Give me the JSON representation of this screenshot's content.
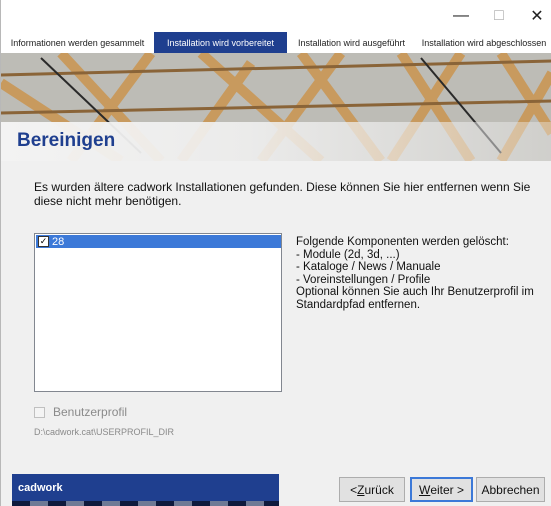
{
  "window": {
    "min_icon": "minimize-icon",
    "max_icon": "maximize-icon",
    "close_icon": "close-icon"
  },
  "steps": [
    {
      "label": "Informationen werden gesammelt"
    },
    {
      "label": "Installation wird vorbereitet"
    },
    {
      "label": "Installation wird ausgeführt"
    },
    {
      "label": "Installation wird abgeschlossen"
    }
  ],
  "banner": {
    "title": "Bereinigen"
  },
  "description": "Es wurden ältere cadwork Installationen gefunden. Diese können Sie hier entfernen wenn Sie diese nicht mehr benötigen.",
  "list": {
    "items": [
      {
        "label": "28",
        "checked": true
      }
    ]
  },
  "info_text": "Folgende Komponenten werden gelöscht:\n- Module (2d, 3d, ...)\n- Kataloge / News / Manuale\n- Voreinstellungen / Profile\nOptional können Sie auch Ihr Benutzerprofil im Standardpfad entfernen.",
  "profile": {
    "label": "Benutzerprofil",
    "path": "D:\\cadwork.cat\\USERPROFIL_DIR"
  },
  "footer": {
    "brand": "cadwork",
    "back_prefix": "< ",
    "back_key": "Z",
    "back_rest": "urück",
    "next_key": "W",
    "next_rest": "eiter >",
    "cancel": "Abbrechen"
  },
  "colors": {
    "accent": "#1f3f8f",
    "selection": "#3c79d8"
  }
}
